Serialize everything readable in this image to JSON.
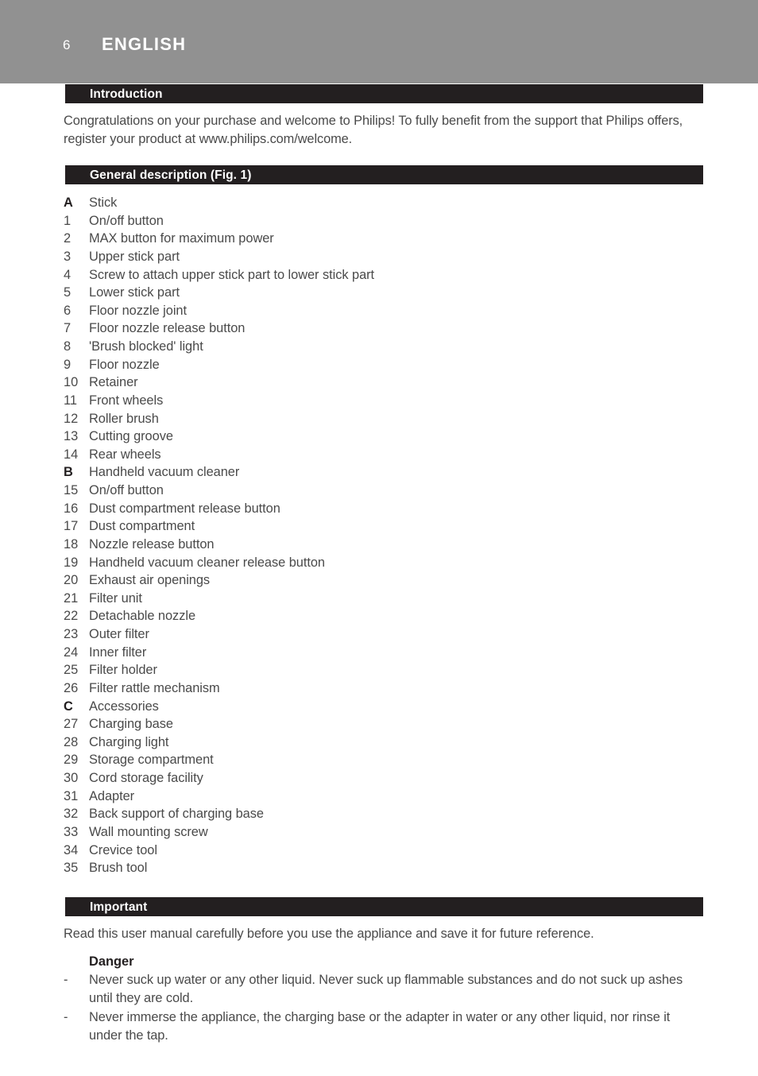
{
  "header": {
    "page_number": "6",
    "language": "ENGLISH",
    "band_color": "#919191"
  },
  "theme": {
    "bar_color": "#231f20",
    "body_text_color": "#4a4a4a",
    "page_background": "#ffffff"
  },
  "sections": {
    "introduction": {
      "title": "Introduction",
      "body": "Congratulations on your purchase and welcome to Philips! To fully benefit from the support that Philips offers, register your product at www.philips.com/welcome."
    },
    "general_description": {
      "title": "General description (Fig. 1)",
      "items": [
        {
          "key": "A",
          "label": "Stick",
          "bold": true
        },
        {
          "key": "1",
          "label": "On/off button",
          "bold": false
        },
        {
          "key": "2",
          "label": "MAX button for maximum power",
          "bold": false
        },
        {
          "key": "3",
          "label": "Upper stick part",
          "bold": false
        },
        {
          "key": "4",
          "label": "Screw to attach upper stick part to lower stick part",
          "bold": false
        },
        {
          "key": "5",
          "label": "Lower stick part",
          "bold": false
        },
        {
          "key": "6",
          "label": "Floor nozzle joint",
          "bold": false
        },
        {
          "key": "7",
          "label": "Floor nozzle release button",
          "bold": false
        },
        {
          "key": "8",
          "label": "'Brush blocked' light",
          "bold": false
        },
        {
          "key": "9",
          "label": "Floor nozzle",
          "bold": false
        },
        {
          "key": "10",
          "label": "Retainer",
          "bold": false
        },
        {
          "key": "11",
          "label": "Front wheels",
          "bold": false
        },
        {
          "key": "12",
          "label": "Roller brush",
          "bold": false
        },
        {
          "key": "13",
          "label": "Cutting groove",
          "bold": false
        },
        {
          "key": "14",
          "label": "Rear wheels",
          "bold": false
        },
        {
          "key": "B",
          "label": "Handheld vacuum cleaner",
          "bold": true
        },
        {
          "key": "15",
          "label": "On/off button",
          "bold": false
        },
        {
          "key": "16",
          "label": "Dust compartment release button",
          "bold": false
        },
        {
          "key": "17",
          "label": "Dust compartment",
          "bold": false
        },
        {
          "key": "18",
          "label": "Nozzle release button",
          "bold": false
        },
        {
          "key": "19",
          "label": "Handheld vacuum cleaner release button",
          "bold": false
        },
        {
          "key": "20",
          "label": "Exhaust air openings",
          "bold": false
        },
        {
          "key": "21",
          "label": "Filter unit",
          "bold": false
        },
        {
          "key": "22",
          "label": "Detachable nozzle",
          "bold": false
        },
        {
          "key": "23",
          "label": "Outer filter",
          "bold": false
        },
        {
          "key": "24",
          "label": "Inner filter",
          "bold": false
        },
        {
          "key": "25",
          "label": "Filter holder",
          "bold": false
        },
        {
          "key": "26",
          "label": "Filter rattle mechanism",
          "bold": false
        },
        {
          "key": "C",
          "label": "Accessories",
          "bold": true
        },
        {
          "key": "27",
          "label": "Charging base",
          "bold": false
        },
        {
          "key": "28",
          "label": "Charging light",
          "bold": false
        },
        {
          "key": "29",
          "label": "Storage compartment",
          "bold": false
        },
        {
          "key": "30",
          "label": "Cord storage facility",
          "bold": false
        },
        {
          "key": "31",
          "label": "Adapter",
          "bold": false
        },
        {
          "key": "32",
          "label": "Back support of charging base",
          "bold": false
        },
        {
          "key": "33",
          "label": "Wall mounting screw",
          "bold": false
        },
        {
          "key": "34",
          "label": "Crevice tool",
          "bold": false
        },
        {
          "key": "35",
          "label": "Brush tool",
          "bold": false
        }
      ]
    },
    "important": {
      "title": "Important",
      "body": "Read this user manual carefully before you use the appliance and save it for future reference.",
      "danger": {
        "heading": "Danger",
        "bullet_marker": "-",
        "bullets": [
          "Never suck up water or any other liquid. Never suck up flammable substances and do not suck up ashes until they are cold.",
          "Never immerse the appliance, the charging base or the adapter in water or any other liquid, nor rinse it under the tap."
        ]
      }
    }
  }
}
